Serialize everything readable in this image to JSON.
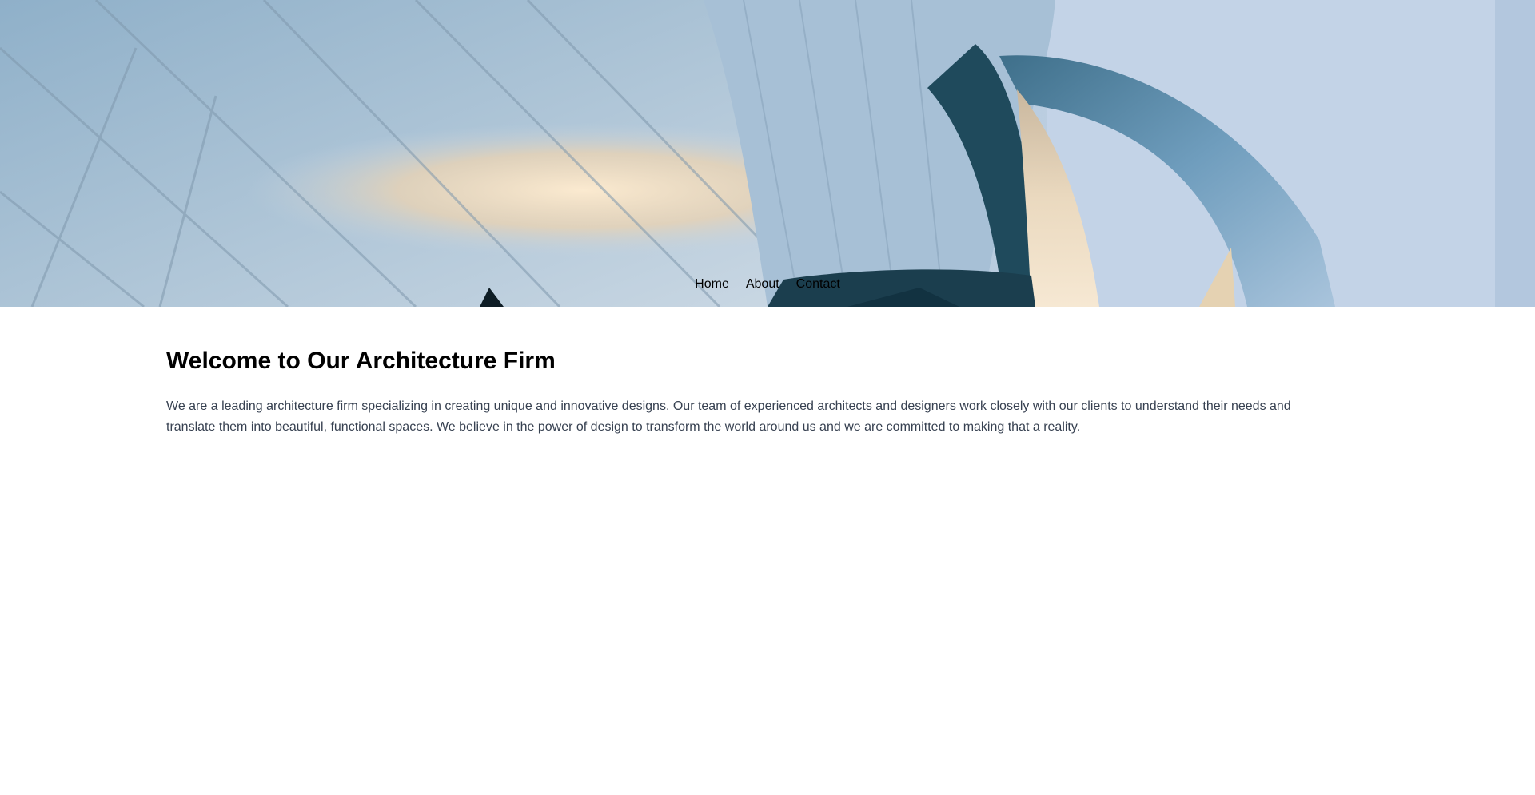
{
  "hero": {
    "image": "abstract-architecture-photo"
  },
  "nav": {
    "items": [
      {
        "label": "Home"
      },
      {
        "label": "About"
      },
      {
        "label": "Contact"
      }
    ]
  },
  "main": {
    "title": "Welcome to Our Architecture Firm",
    "paragraph": "We are a leading architecture firm specializing in creating unique and innovative designs. Our team of experienced architects and designers work closely with our clients to understand their needs and translate them into beautiful, functional spaces. We believe in the power of design to transform the world around us and we are committed to making that a reality."
  },
  "colors": {
    "title": "#000000",
    "body_text": "#374151",
    "nav_text": "#000000"
  }
}
